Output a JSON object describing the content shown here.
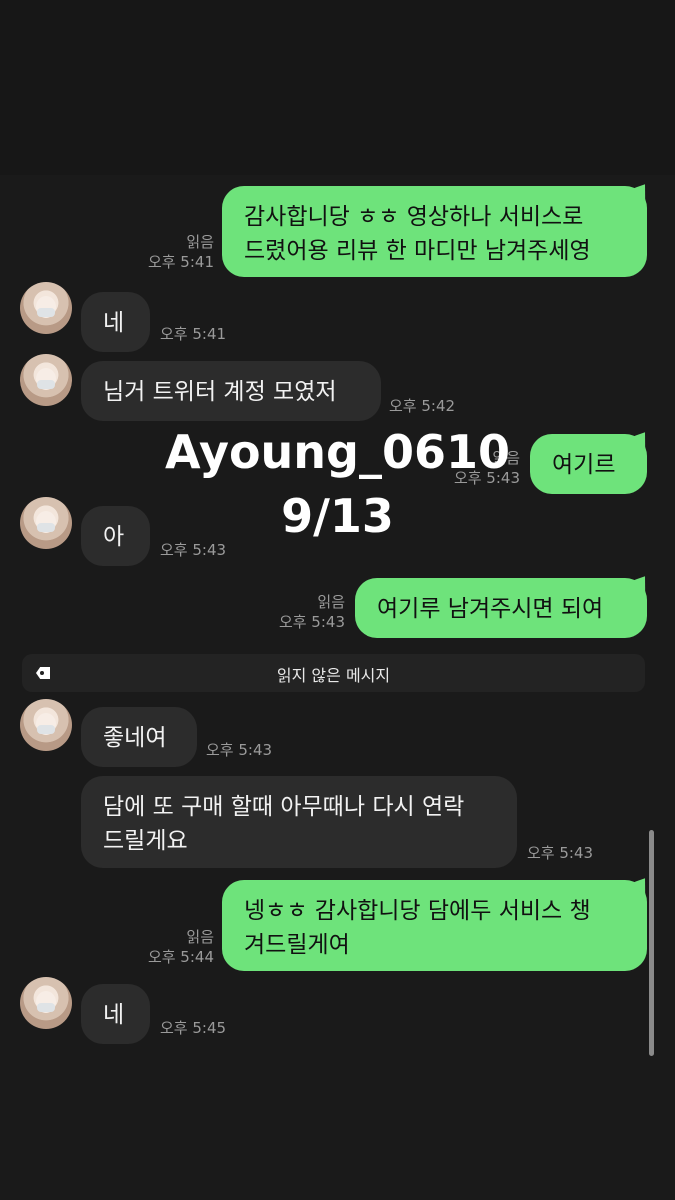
{
  "messages": [
    {
      "side": "out",
      "text": "감사합니당 ㅎㅎ 영상하나 서비스로\n드렸어용 리뷰 한 마디만 남겨주세영",
      "read": "읽음",
      "time": "오후 5:41"
    },
    {
      "side": "in",
      "text": "네",
      "time": "오후 5:41"
    },
    {
      "side": "in",
      "text": "님거 트위터 계정 모였저",
      "time": "오후 5:42"
    },
    {
      "side": "out",
      "text": "여기르",
      "read": "읽음",
      "time": "오후 5:43"
    },
    {
      "side": "in",
      "text": "아",
      "time": "오후 5:43"
    },
    {
      "side": "out",
      "text": "여기루 남겨주시면 되여",
      "read": "읽음",
      "time": "오후 5:43"
    },
    {
      "side": "in",
      "text": "좋네여",
      "time": "오후 5:43"
    },
    {
      "side": "in",
      "text": "담에 또 구매 할때 아무때나 다시 연락\n드릴게요",
      "time": "오후 5:43"
    },
    {
      "side": "out",
      "text": "넹ㅎㅎ 감사합니당 담에두 서비스 챙\n겨드릴게여",
      "read": "읽음",
      "time": "오후 5:44"
    },
    {
      "side": "in",
      "text": "네",
      "time": "오후 5:45"
    }
  ],
  "divider": {
    "text": "읽지 않은 메시지"
  },
  "overlay": {
    "line1": "Ayoung_0610",
    "line2": "9/13"
  },
  "colors": {
    "background": "#1a1a1a",
    "incoming": "#2c2c2c",
    "outgoing": "#6ee37b",
    "meta": "#9a9a9a"
  }
}
